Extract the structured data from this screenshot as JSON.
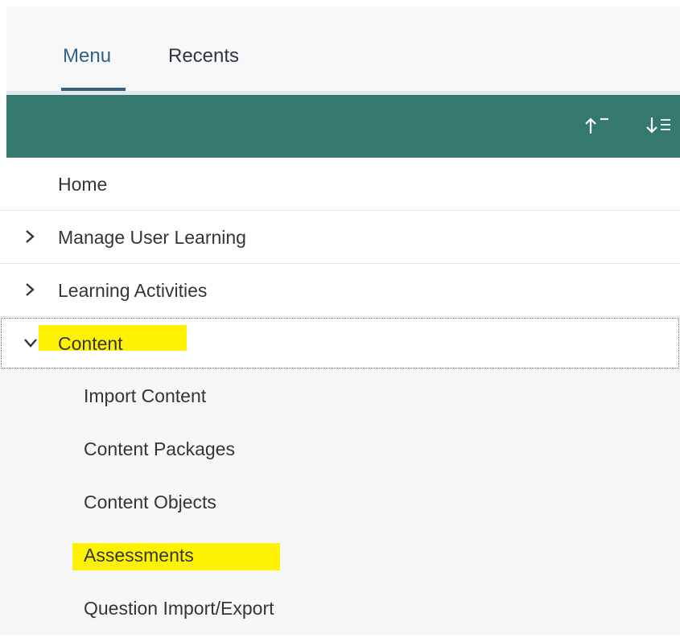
{
  "tabs": {
    "menu_label": "Menu",
    "recents_label": "Recents",
    "active": "Menu"
  },
  "toolbar": {
    "sort_ascending_icon": "sort-ascending-icon",
    "sort_descending_icon": "sort-descending-icon",
    "color": "#35796c"
  },
  "menu": {
    "items": [
      {
        "label": "Home",
        "expandable": false
      },
      {
        "label": "Manage User Learning",
        "expandable": true,
        "expanded": false
      },
      {
        "label": "Learning Activities",
        "expandable": true,
        "expanded": false
      },
      {
        "label": "Content",
        "expandable": true,
        "expanded": true,
        "highlighted": true
      }
    ],
    "content_children": [
      {
        "label": "Import Content"
      },
      {
        "label": "Content Packages"
      },
      {
        "label": "Content Objects"
      },
      {
        "label": "Assessments",
        "highlighted": true
      },
      {
        "label": "Question Import/Export"
      }
    ]
  },
  "colors": {
    "highlight": "#fff200",
    "active_tab": "#346187"
  }
}
